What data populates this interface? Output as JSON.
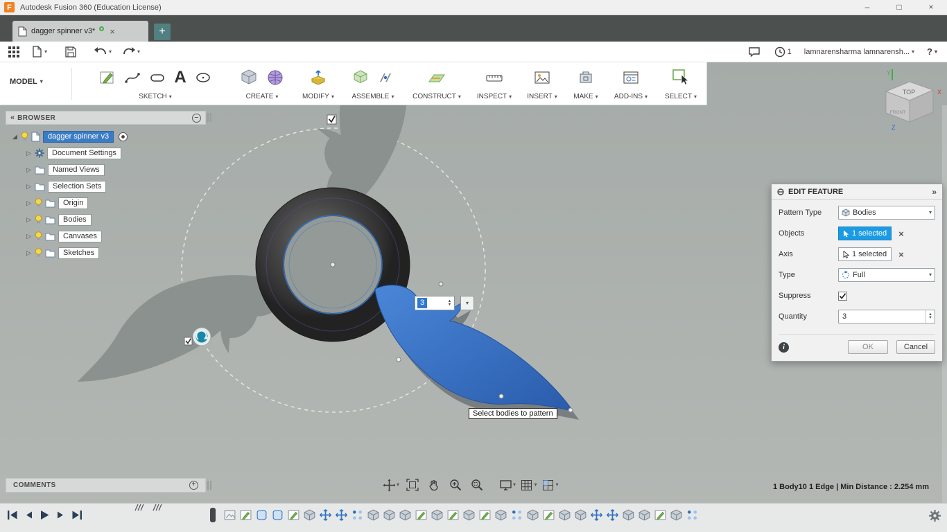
{
  "titlebar": {
    "title": "Autodesk Fusion 360 (Education License)"
  },
  "tabbar": {
    "tab_label": "dagger spinner v3*"
  },
  "qat": {
    "notification_count": "1",
    "user_name": "lamnarensharma lamnarensh...",
    "help": "?"
  },
  "ribbon": {
    "model_label": "MODEL",
    "text_tool_glyph": "A",
    "groups": [
      {
        "label": "SKETCH"
      },
      {
        "label": "CREATE"
      },
      {
        "label": "MODIFY"
      },
      {
        "label": "ASSEMBLE"
      },
      {
        "label": "CONSTRUCT"
      },
      {
        "label": "INSPECT"
      },
      {
        "label": "INSERT"
      },
      {
        "label": "MAKE"
      },
      {
        "label": "ADD-INS"
      },
      {
        "label": "SELECT"
      }
    ]
  },
  "browser": {
    "header": "BROWSER",
    "root_label": "dagger spinner v3",
    "items": [
      {
        "label": "Document Settings"
      },
      {
        "label": "Named Views"
      },
      {
        "label": "Selection Sets"
      },
      {
        "label": "Origin"
      },
      {
        "label": "Bodies"
      },
      {
        "label": "Canvases"
      },
      {
        "label": "Sketches"
      }
    ]
  },
  "viewcube": {
    "top": "TOP",
    "front": "FRONT",
    "axis_x": "X",
    "axis_y": "Y",
    "axis_z": "Z"
  },
  "canvas": {
    "quantity_input_value": "3",
    "tooltip": "Select bodies to pattern"
  },
  "dialog": {
    "title": "EDIT FEATURE",
    "pattern_type_label": "Pattern Type",
    "pattern_type_value": "Bodies",
    "objects_label": "Objects",
    "objects_value": "1 selected",
    "axis_label": "Axis",
    "axis_value": "1 selected",
    "type_label": "Type",
    "type_value": "Full",
    "suppress_label": "Suppress",
    "suppress_checked": true,
    "quantity_label": "Quantity",
    "quantity_value": "3",
    "ok_label": "OK",
    "cancel_label": "Cancel"
  },
  "comments": {
    "header": "COMMENTS"
  },
  "statusbar": {
    "selection_info": "1 Body10 1 Edge | Min Distance : 2.254 mm"
  },
  "timeline": {
    "icons": [
      "canvas",
      "sketch",
      "revolve",
      "revolve",
      "sketch",
      "extrude",
      "move",
      "move",
      "pattern",
      "extrude",
      "extrude",
      "extrude",
      "sketch",
      "extrude",
      "sketch",
      "extrude",
      "sketch",
      "extrude",
      "pattern",
      "extrude",
      "sketch",
      "extrude",
      "extrude",
      "move",
      "move",
      "extrude",
      "extrude",
      "sketch",
      "extrude",
      "pattern"
    ]
  },
  "icons": {
    "caret": "▾",
    "tri_collapsed": "▷",
    "tri_expanded": "◢",
    "collapse": "«",
    "expand": "»",
    "close": "×",
    "plus": "+",
    "minus": "–",
    "spin_up": "▲",
    "spin_down": "▼",
    "minimize": "–",
    "maximize": "□",
    "window_close": "×"
  }
}
